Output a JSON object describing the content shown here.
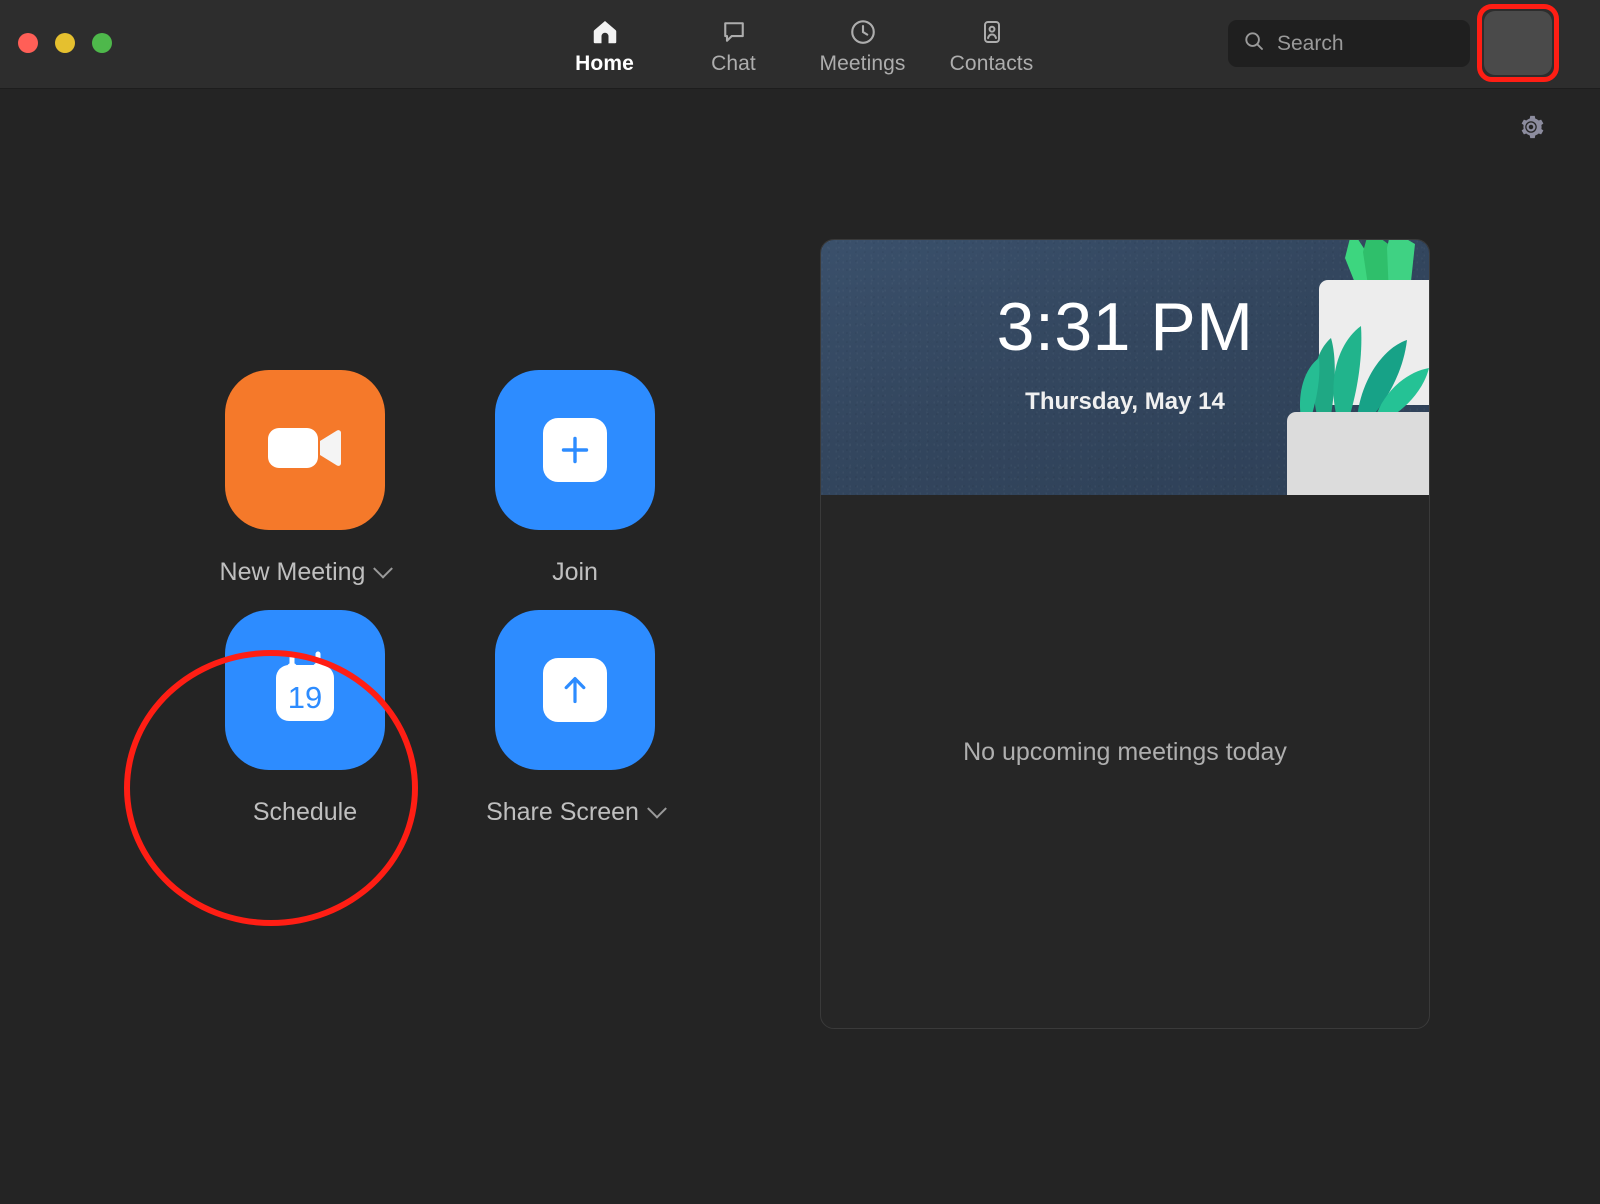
{
  "window": {
    "traffic_lights": [
      {
        "name": "close",
        "color": "#FF5F57"
      },
      {
        "name": "minimize",
        "color": "#E5C02F"
      },
      {
        "name": "maximize",
        "color": "#4EB84B"
      }
    ]
  },
  "nav": {
    "tabs": [
      {
        "label": "Home",
        "icon": "home-icon",
        "active": true
      },
      {
        "label": "Chat",
        "icon": "chat-bubble-icon",
        "active": false
      },
      {
        "label": "Meetings",
        "icon": "clock-icon",
        "active": false
      },
      {
        "label": "Contacts",
        "icon": "contact-card-icon",
        "active": false
      }
    ]
  },
  "search": {
    "placeholder": "Search",
    "value": "",
    "icon": "search-icon"
  },
  "profile": {
    "avatar_label": "",
    "highlighted": true
  },
  "settings": {
    "icon": "gear-icon",
    "label": ""
  },
  "actions": [
    {
      "label": "New Meeting",
      "icon": "video-camera-icon",
      "color": "#F5792A",
      "has_dropdown": true,
      "highlighted": false
    },
    {
      "label": "Join",
      "icon": "plus-icon",
      "color": "#2D8CFF",
      "has_dropdown": false,
      "highlighted": false
    },
    {
      "label": "Schedule",
      "icon": "calendar-icon",
      "color": "#2D8CFF",
      "has_dropdown": false,
      "highlighted": true,
      "calendar_day": "19"
    },
    {
      "label": "Share Screen",
      "icon": "up-arrow-icon",
      "color": "#2D8CFF",
      "has_dropdown": true,
      "highlighted": false
    }
  ],
  "panel": {
    "time": "3:31 PM",
    "date": "Thursday, May 14",
    "empty_message": "No upcoming meetings today",
    "banner_color": "#33465E",
    "illustration": "potted-plant-illustration"
  },
  "annotations": {
    "accent_color": "#FF1E14",
    "circle_target": "Schedule",
    "rect_target": "profile-avatar"
  }
}
